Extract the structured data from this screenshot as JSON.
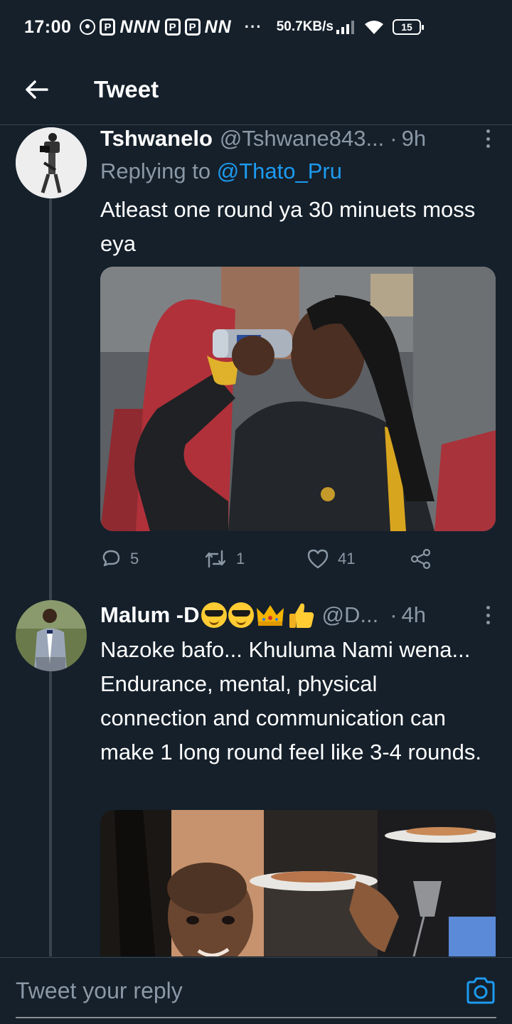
{
  "status_bar": {
    "time": "17:00",
    "notification_glyphs": "P N N N P P N N",
    "overflow": "···",
    "network_speed": "50.7KB/s",
    "battery": "15"
  },
  "app_bar": {
    "title": "Tweet",
    "back_icon": "arrow-left-icon"
  },
  "tweets": [
    {
      "name": "Tshwanelo",
      "handle": "@Tshwane843...",
      "dot": "·",
      "time": "9h",
      "replying_prefix": "Replying to ",
      "replying_to": "@Thato_Pru",
      "text": "Atleast one round ya 30 minuets moss eya",
      "media": "photo of man drinking from a can",
      "counts": {
        "replies": "5",
        "retweets": "1",
        "likes": "41"
      }
    },
    {
      "name": "Malum -D",
      "handle": "@D...",
      "dot": "·",
      "time": "4h",
      "text": "Nazoke bafo... Khuluma Nami wena... Endurance, mental, physical connection and communication can make 1 long round feel like 3-4 rounds.",
      "media": "photo of boy smiling at a party"
    }
  ],
  "reply_bar": {
    "placeholder": "Tweet your reply",
    "camera_icon": "camera-icon"
  },
  "colors": {
    "background": "#15202b",
    "accent": "#1d9bf0",
    "muted": "#8b98a5",
    "divider": "#38444d"
  }
}
